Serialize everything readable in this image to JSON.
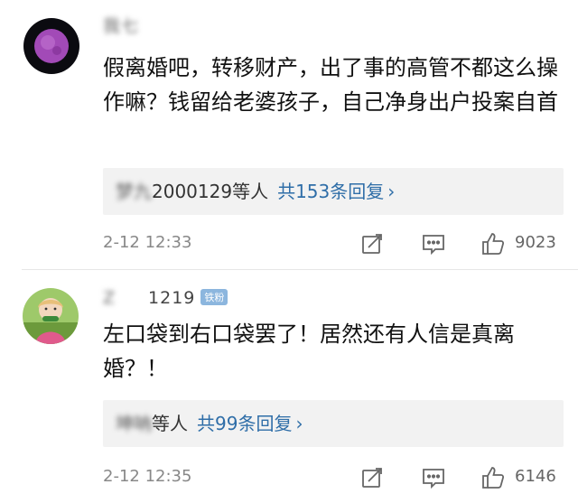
{
  "comments": [
    {
      "username": "我七",
      "content": "假离婚吧，转移财产，出了事的高管不都这么操作嘛？钱留给老婆孩子，自己净身出户投案自首",
      "reply_names_hidden": "梦九",
      "reply_names": "2000129等人",
      "reply_count": "共153条回复",
      "chevron": "›",
      "time": "2-12 12:33",
      "likes": "9023"
    },
    {
      "username_hidden": "Z",
      "username": "1219",
      "badge": "铁粉",
      "content": "左口袋到右口袋罢了！居然还有人信是真离婚？！",
      "reply_names_hidden": "坤呐",
      "reply_names": "等人",
      "reply_count": "共99条回复",
      "chevron": "›",
      "time": "2-12 12:35",
      "likes": "6146"
    }
  ],
  "icons": {
    "share": "edit-share-icon",
    "comment": "comment-icon",
    "like": "thumbs-up-icon"
  },
  "colors": {
    "link": "#2f6ea8",
    "badge": "#8cb6de",
    "reply_bg": "#f2f2f2",
    "muted": "#888888"
  }
}
